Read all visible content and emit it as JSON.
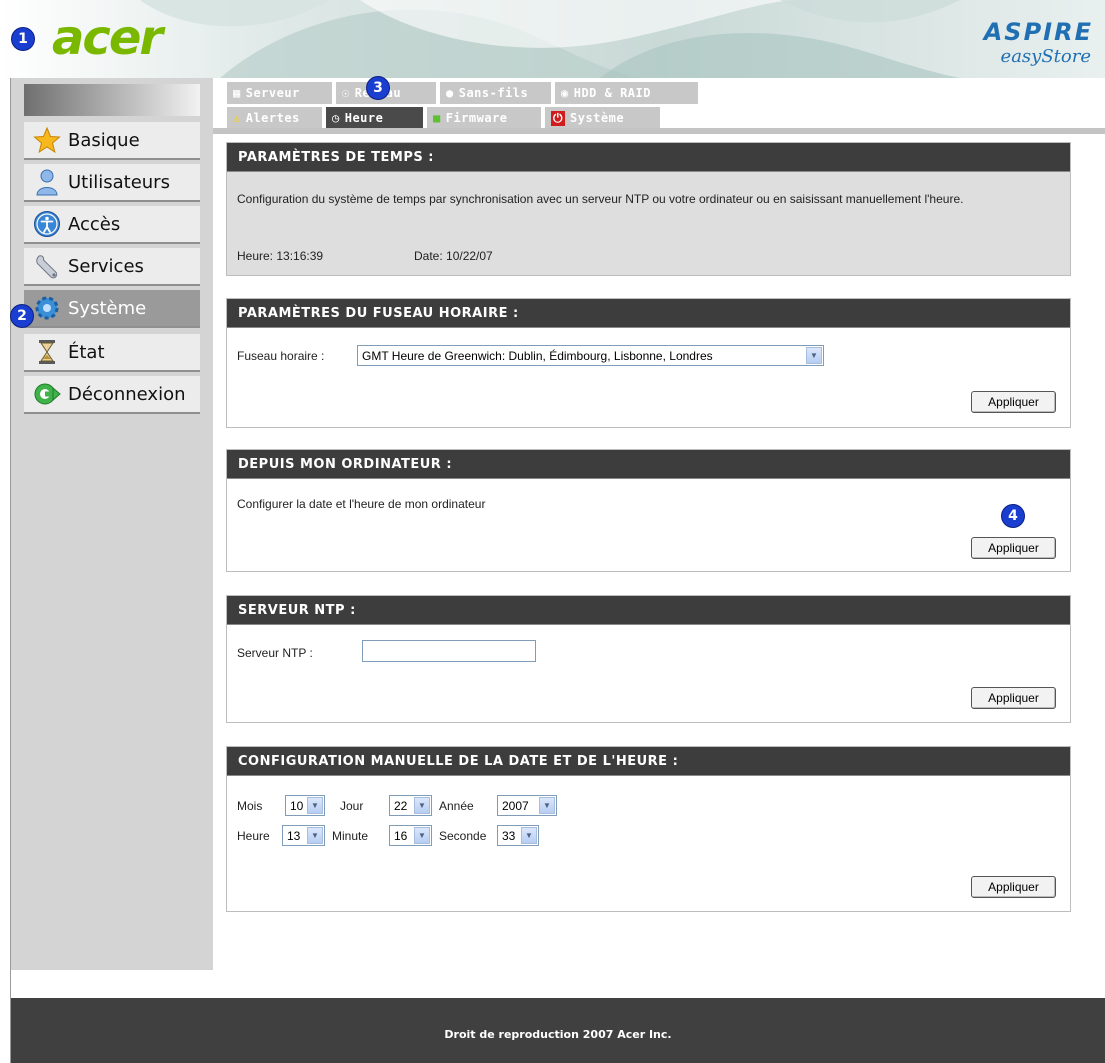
{
  "header": {
    "logo": "acer",
    "brand_title": "ASPIRE",
    "brand_subtitle": "easyStore"
  },
  "markers": [
    "1",
    "2",
    "3",
    "4"
  ],
  "sidebar": {
    "items": [
      {
        "label": "Basique",
        "icon": "star-icon"
      },
      {
        "label": "Utilisateurs",
        "icon": "user-icon"
      },
      {
        "label": "Accès",
        "icon": "accessibility-icon"
      },
      {
        "label": "Services",
        "icon": "wrench-icon"
      },
      {
        "label": "Système",
        "icon": "gear-icon",
        "active": true
      },
      {
        "label": "État",
        "icon": "hourglass-icon"
      },
      {
        "label": "Déconnexion",
        "icon": "logout-icon"
      }
    ]
  },
  "tabs": {
    "row1": [
      {
        "label": "Serveur",
        "icon": "server-icon"
      },
      {
        "label": "Réseau",
        "icon": "network-icon"
      },
      {
        "label": "Sans-fils",
        "icon": "globe-icon"
      },
      {
        "label": "HDD & RAID",
        "icon": "disk-icon"
      }
    ],
    "row2": [
      {
        "label": "Alertes",
        "icon": "warning-icon"
      },
      {
        "label": "Heure",
        "icon": "clock-icon",
        "active": true
      },
      {
        "label": "Firmware",
        "icon": "firmware-icon"
      },
      {
        "label": "Système",
        "icon": "power-icon"
      }
    ]
  },
  "time_params": {
    "title": "PARAMÈTRES DE TEMPS :",
    "description": "Configuration du système de temps par synchronisation avec un serveur NTP ou votre ordinateur ou en saisissant manuellement l'heure.",
    "time_label": "Heure: 13:16:39",
    "date_label": "Date: 10/22/07"
  },
  "timezone": {
    "title": "PARAMÈTRES DU FUSEAU HORAIRE :",
    "label": "Fuseau horaire :",
    "selected": "GMT Heure de Greenwich: Dublin, Édimbourg, Lisbonne, Londres",
    "apply": "Appliquer"
  },
  "from_computer": {
    "title": "DEPUIS MON ORDINATEUR :",
    "description": "Configurer la date et l'heure de mon ordinateur",
    "apply": "Appliquer"
  },
  "ntp": {
    "title": "SERVEUR NTP :",
    "label": "Serveur NTP :",
    "value": "",
    "apply": "Appliquer"
  },
  "manual": {
    "title": "CONFIGURATION MANUELLE DE LA DATE ET DE L'HEURE :",
    "month_label": "Mois",
    "month": "10",
    "day_label": "Jour",
    "day": "22",
    "year_label": "Année",
    "year": "2007",
    "hour_label": "Heure",
    "hour": "13",
    "minute_label": "Minute",
    "minute": "16",
    "second_label": "Seconde",
    "second": "33",
    "apply": "Appliquer"
  },
  "footer": {
    "copyright": "Droit de reproduction 2007 Acer Inc."
  },
  "colors": {
    "accent_green": "#7ab800",
    "brand_blue": "#1f6fb2",
    "marker_blue": "#1a3fd0",
    "section_header": "#3d3d3d"
  }
}
